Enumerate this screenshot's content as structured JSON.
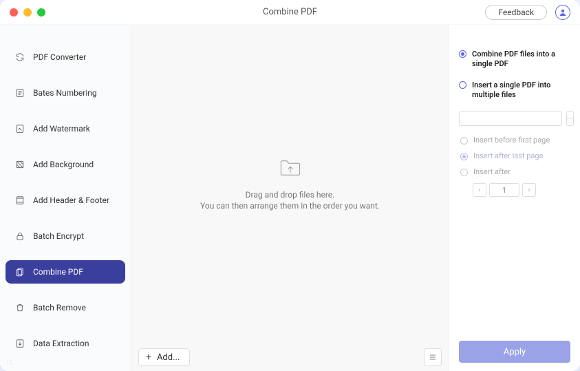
{
  "window_title": "Combine PDF",
  "feedback_label": "Feedback",
  "sidebar": {
    "items": [
      {
        "label": "PDF Converter",
        "icon": "convert-icon"
      },
      {
        "label": "Bates Numbering",
        "icon": "bates-icon"
      },
      {
        "label": "Add Watermark",
        "icon": "watermark-icon"
      },
      {
        "label": "Add Background",
        "icon": "background-icon"
      },
      {
        "label": "Add Header & Footer",
        "icon": "header-footer-icon"
      },
      {
        "label": "Batch Encrypt",
        "icon": "encrypt-icon"
      },
      {
        "label": "Combine PDF",
        "icon": "combine-icon"
      },
      {
        "label": "Batch Remove",
        "icon": "remove-icon"
      },
      {
        "label": "Data Extraction",
        "icon": "extract-icon"
      }
    ],
    "active_index": 6
  },
  "dropzone": {
    "line1": "Drag and drop files here.",
    "line2": "You can then arrange them in the order you want."
  },
  "bottom": {
    "add_label": "Add..."
  },
  "right": {
    "mode_combine": "Combine PDF files into a single PDF",
    "mode_insert": "Insert a single PDF into multiple files",
    "selected_mode": "combine",
    "file_value": "",
    "browse_glyph": "···",
    "insert_before": "Insert before first page",
    "insert_after_last": "Insert after last page",
    "insert_after": "Insert after",
    "insert_position_selected": "after_last",
    "page_value": "1",
    "apply_label": "Apply"
  }
}
